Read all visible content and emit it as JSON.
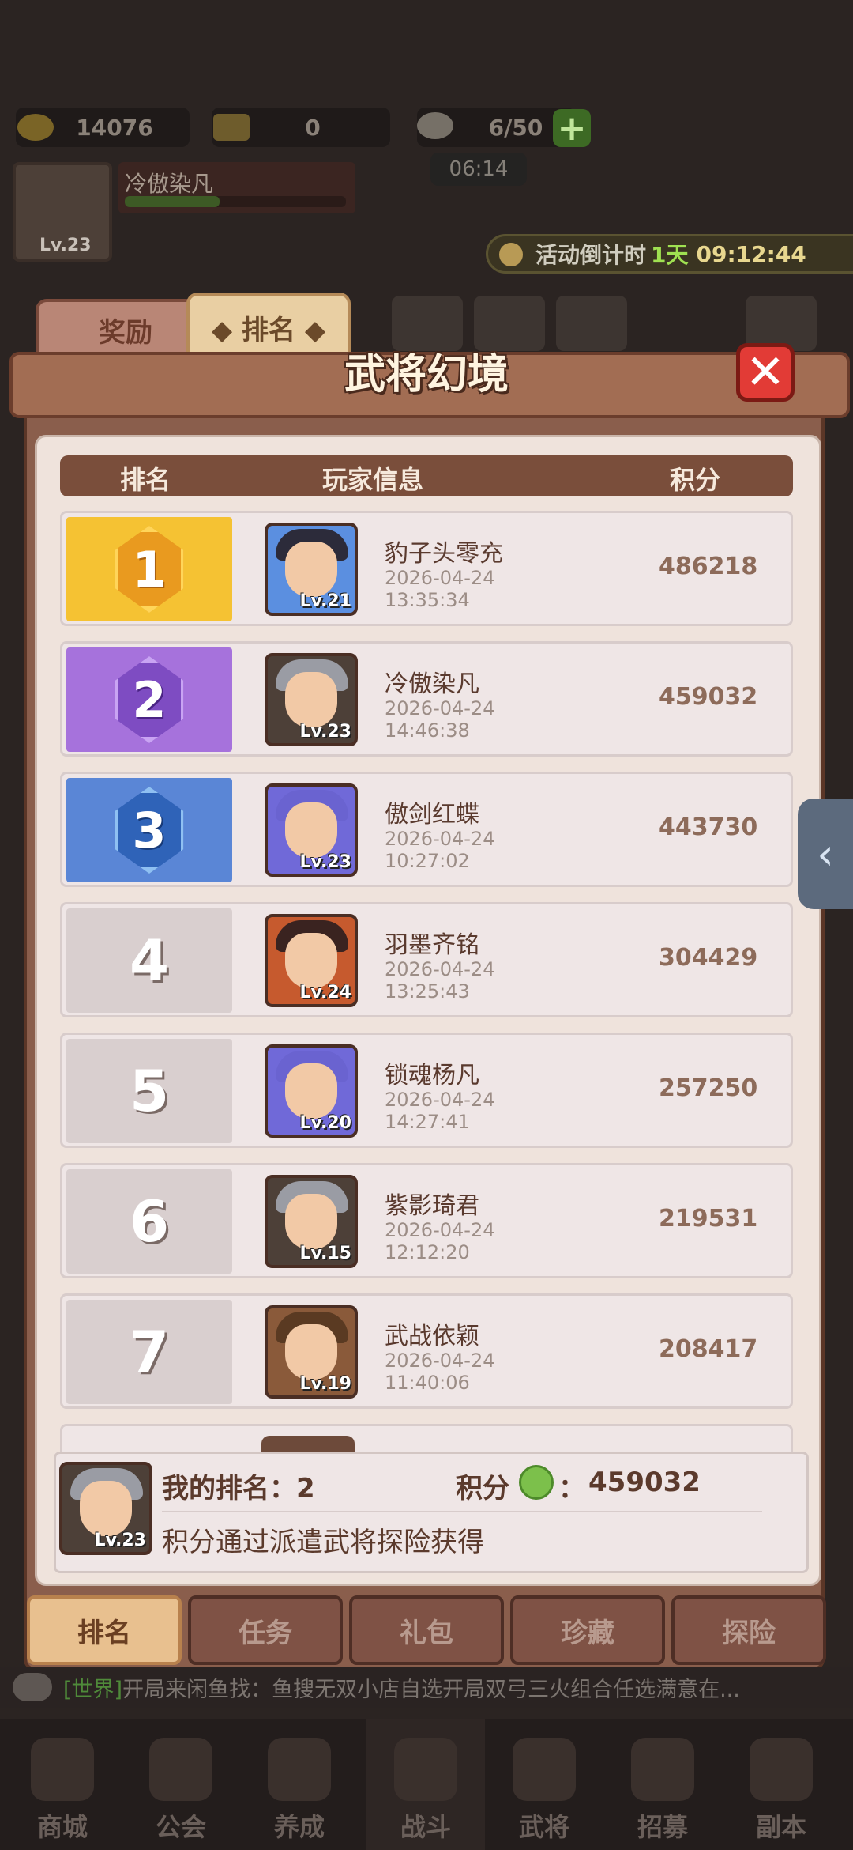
{
  "hud": {
    "gold": "14076",
    "tickets": "0",
    "stamina": "6/50",
    "stamina_timer": "06:14",
    "player_name": "冷傲染凡",
    "player_level": "Lv.23",
    "countdown_label": "活动倒计时",
    "countdown_days": "1天",
    "countdown_time": "09:12:44"
  },
  "top_tabs": {
    "reward": "奖励",
    "rank": "◆ 排名 ◆"
  },
  "panel": {
    "title": "武将幻境",
    "close": "✕"
  },
  "table_header": {
    "rank": "排名",
    "player_info": "玩家信息",
    "score": "积分"
  },
  "rows": [
    {
      "rank": "1",
      "level": "Lv.21",
      "name": "豹子头零充",
      "date": "2026-04-24",
      "time": "13:35:34",
      "score": "486218"
    },
    {
      "rank": "2",
      "level": "Lv.23",
      "name": "冷傲染凡",
      "date": "2026-04-24",
      "time": "14:46:38",
      "score": "459032"
    },
    {
      "rank": "3",
      "level": "Lv.23",
      "name": "傲剑红蝶",
      "date": "2026-04-24",
      "time": "10:27:02",
      "score": "443730"
    },
    {
      "rank": "4",
      "level": "Lv.24",
      "name": "羽墨齐铭",
      "date": "2026-04-24",
      "time": "13:25:43",
      "score": "304429"
    },
    {
      "rank": "5",
      "level": "Lv.20",
      "name": "锁魂杨凡",
      "date": "2026-04-24",
      "time": "14:27:41",
      "score": "257250"
    },
    {
      "rank": "6",
      "level": "Lv.15",
      "name": "紫影琦君",
      "date": "2026-04-24",
      "time": "12:12:20",
      "score": "219531"
    },
    {
      "rank": "7",
      "level": "Lv.19",
      "name": "武战依颖",
      "date": "2026-04-24",
      "time": "11:40:06",
      "score": "208417"
    }
  ],
  "my_info": {
    "level": "Lv.23",
    "rank_label": "我的排名：",
    "rank_value": "2",
    "score_label": "积分",
    "score_sep": "：",
    "score_value": "459032",
    "hint": "积分通过派遣武将探险获得"
  },
  "bottom_tabs": [
    "排名",
    "任务",
    "礼包",
    "珍藏",
    "探险"
  ],
  "chat": {
    "channel": "[世界]",
    "message": "开局来闲鱼找：鱼搜无双小店自选开局双弓三火组合任选满意在..."
  },
  "nav": [
    "商城",
    "公会",
    "养成",
    "战斗",
    "武将",
    "招募",
    "副本"
  ],
  "colors": {
    "gold": "#f5c233",
    "purple": "#a672dc",
    "blue": "#5a86d6",
    "grey": "#d9cfcf",
    "accent_green": "#9fe051"
  },
  "side_arrow": "‹"
}
